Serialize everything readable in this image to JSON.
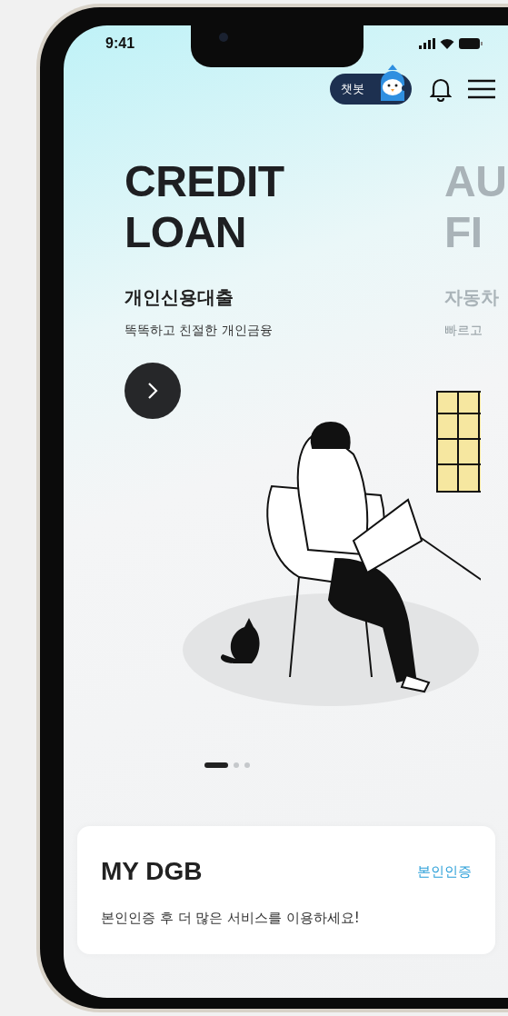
{
  "status_bar": {
    "time": "9:41"
  },
  "header": {
    "chatbot_label": "챗봇"
  },
  "slides": [
    {
      "title": [
        "CREDIT",
        "LOAN"
      ],
      "subtitle": "개인신용대출",
      "description": "똑똑하고 친절한 개인금융",
      "active": true
    },
    {
      "title": [
        "AU",
        "FI"
      ],
      "subtitle": "자동차",
      "description": "빠르고",
      "active": false
    }
  ],
  "pagination": [
    {
      "selected": true
    },
    {
      "selected": false
    },
    {
      "selected": false
    }
  ],
  "my_dgb": {
    "title": "MY DGB",
    "link": "본인인증",
    "message": "본인인증 후 더 많은 서비스를 이용하세요!"
  }
}
